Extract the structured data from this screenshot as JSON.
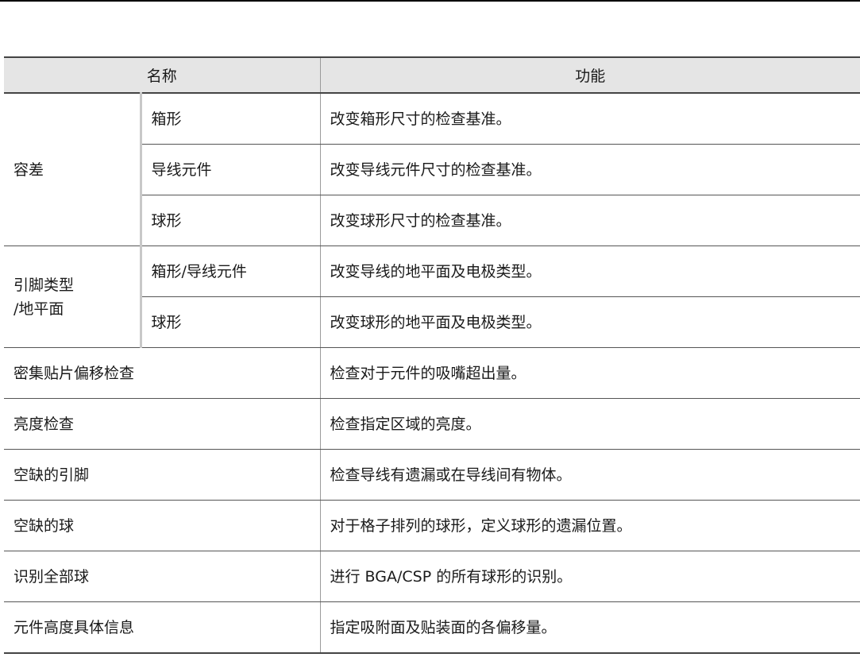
{
  "table": {
    "headers": {
      "name": "名称",
      "function": "功能"
    },
    "groups": [
      {
        "name": "容差",
        "rows": [
          {
            "sub": "箱形",
            "function": "改变箱形尺寸的检查基准。"
          },
          {
            "sub": "导线元件",
            "function": "改变导线元件尺寸的检查基准。"
          },
          {
            "sub": "球形",
            "function": "改变球形尺寸的检查基准。"
          }
        ]
      },
      {
        "name_line1": "引脚类型",
        "name_line2": "/地平面",
        "rows": [
          {
            "sub": "箱形/导线元件",
            "function": "改变导线的地平面及电极类型。"
          },
          {
            "sub": "球形",
            "function": "改变球形的地平面及电极类型。"
          }
        ]
      }
    ],
    "rows": [
      {
        "name": "密集贴片偏移检查",
        "function": "检查对于元件的吸嘴超出量。"
      },
      {
        "name": "亮度检查",
        "function": "检查指定区域的亮度。"
      },
      {
        "name": "空缺的引脚",
        "function": "检查导线有遗漏或在导线间有物体。"
      },
      {
        "name": "空缺的球",
        "function": "对于格子排列的球形，定义球形的遗漏位置。"
      },
      {
        "name": "识别全部球",
        "function": "进行 BGA/CSP 的所有球形的识别。"
      },
      {
        "name": "元件高度具体信息",
        "function": "指定吸附面及贴装面的各偏移量。"
      }
    ]
  }
}
